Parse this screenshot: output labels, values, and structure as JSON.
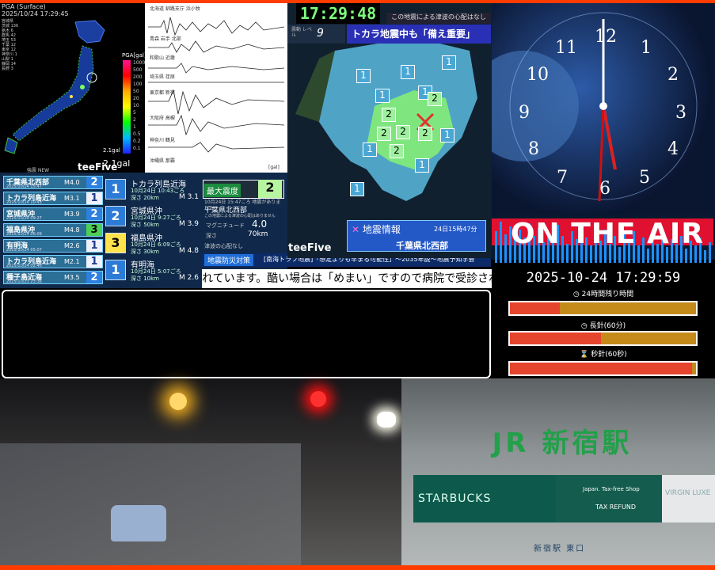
{
  "pga": {
    "header": "PGA (Surface)",
    "timestamp": "2025/10/24 17:29:45",
    "legend_title": "PGA[gal]",
    "legend_ticks": [
      "1000",
      "500",
      "200",
      "100",
      "50",
      "20",
      "10",
      "5",
      "2",
      "1",
      "0.5",
      "0.2",
      "0.1"
    ],
    "gal_small": "2.1gal",
    "gal_value": "2.1gal",
    "stations_left": [
      "宮城県",
      "茨城 136",
      "栃木 6",
      "群馬 42",
      "埼玉 53",
      "千葉 12",
      "東京 12",
      "神奈川 1",
      "山梨 1",
      "静岡 14",
      "長野 3"
    ],
    "brand": "teeFive",
    "sub_brand": "強震 NEW"
  },
  "seismograph": {
    "labels": [
      "北海道 釧路支庁 浜小牧",
      "青森 岩手 北部",
      "和歌山 近畿",
      "埼玉県 荏原",
      "東京都 新宿",
      "大阪府 高槻",
      "神奈川 鶴見",
      "沖縄県 那覇"
    ],
    "footer": "[gal]"
  },
  "quake_list": [
    {
      "name": "千葉県北西部",
      "time": "2025/10/24 15:47",
      "mag": "M4.0",
      "intensity": "2",
      "cls": "i2"
    },
    {
      "name": "トカラ列島近海",
      "time": "2025/10/24 10:43",
      "mag": "M3.1",
      "intensity": "1",
      "cls": "i1"
    },
    {
      "name": "宮城県沖",
      "time": "2025/10/24 09:27",
      "mag": "M3.9",
      "intensity": "2",
      "cls": "i2"
    },
    {
      "name": "福島県沖",
      "time": "2025/10/24 06:09",
      "mag": "M4.8",
      "intensity": "3",
      "cls": "i3"
    },
    {
      "name": "有明海",
      "time": "2025/10/24 05:07",
      "mag": "M2.6",
      "intensity": "1",
      "cls": "i1"
    },
    {
      "name": "トカラ列島近海",
      "time": "2025/10/24 02:40",
      "mag": "M2.1",
      "intensity": "1",
      "cls": "i1"
    },
    {
      "name": "種子島近海",
      "time": "2025/10/23 23:36",
      "mag": "M3.5",
      "intensity": "2",
      "cls": "i2"
    }
  ],
  "detail_list": [
    {
      "badge": "1",
      "name": "トカラ列島近海",
      "time": "10月24日 10:43ごろ",
      "depth": "深さ 20km",
      "mag": "M 3.1",
      "cls": ""
    },
    {
      "badge": "2",
      "name": "宮城県沖",
      "time": "10月24日 9:27ごろ",
      "depth": "深さ 50km",
      "mag": "M 3.9",
      "cls": ""
    },
    {
      "badge": "3",
      "name": "福島県沖",
      "time": "10月24日 6:09ごろ",
      "depth": "深さ 30km",
      "mag": "M 4.8",
      "cls": "b3"
    },
    {
      "badge": "1",
      "name": "有明海",
      "time": "10月24日 5:07ごろ",
      "depth": "深さ 10km",
      "mag": "M 2.6",
      "cls": ""
    }
  ],
  "max_intensity": {
    "label": "最大震度",
    "value": "2",
    "occurred": "10月24日 15:47ごろ 地震がありました",
    "epicenter": "千葉県北西部",
    "tsunami_note": "この地震による津波の心配はありません",
    "mag_label": "マグニチュード",
    "mag_value": "4.0",
    "depth_label": "深さ",
    "depth_value": "70km",
    "footer": "津波の心配なし"
  },
  "ticker": {
    "tag": "地震防災対策",
    "headline": "[南海トラフ地震]「想定よりも早まる可能性」～2035年説～地震予知学会",
    "scroll": "れています。酷い場合は「めまい」ですので病院で受診されることをお勧"
  },
  "map": {
    "clock": "17:29:48",
    "top_note": "この地震による津波の心配はなし",
    "level_label": "震動 レベル",
    "level_value": "9",
    "headline": "トカラ地震中も「備え重要」",
    "brand": "teeFive",
    "info_title": "地震情報",
    "info_date": "24日15時47分",
    "info_region": "千葉県北西部",
    "intensity_markers": [
      "1",
      "1",
      "1",
      "1",
      "1",
      "2",
      "2",
      "2",
      "2",
      "2",
      "2",
      "1",
      "1",
      "1",
      "1"
    ]
  },
  "clock": {
    "numerals": [
      "12",
      "1",
      "2",
      "3",
      "4",
      "5",
      "6",
      "7",
      "8",
      "9",
      "10",
      "11"
    ],
    "banner": "ON THE AIR",
    "datetime": "2025-10-24 17:29:59"
  },
  "progress": [
    {
      "label": "24時間残り時間",
      "fill": 0.27
    },
    {
      "label": "長針(60分)",
      "fill": 0.49
    },
    {
      "label": "秒針(60秒)",
      "fill": 0.98
    }
  ],
  "cameras": {
    "station_name": "新宿駅",
    "starbucks": "STARBUCKS",
    "tax_top": "Japan. Tax-free Shop",
    "tax_refund": "TAX REFUND",
    "exit": "新宿駅 東口",
    "right_sign": "VIRGIN LUXE"
  }
}
